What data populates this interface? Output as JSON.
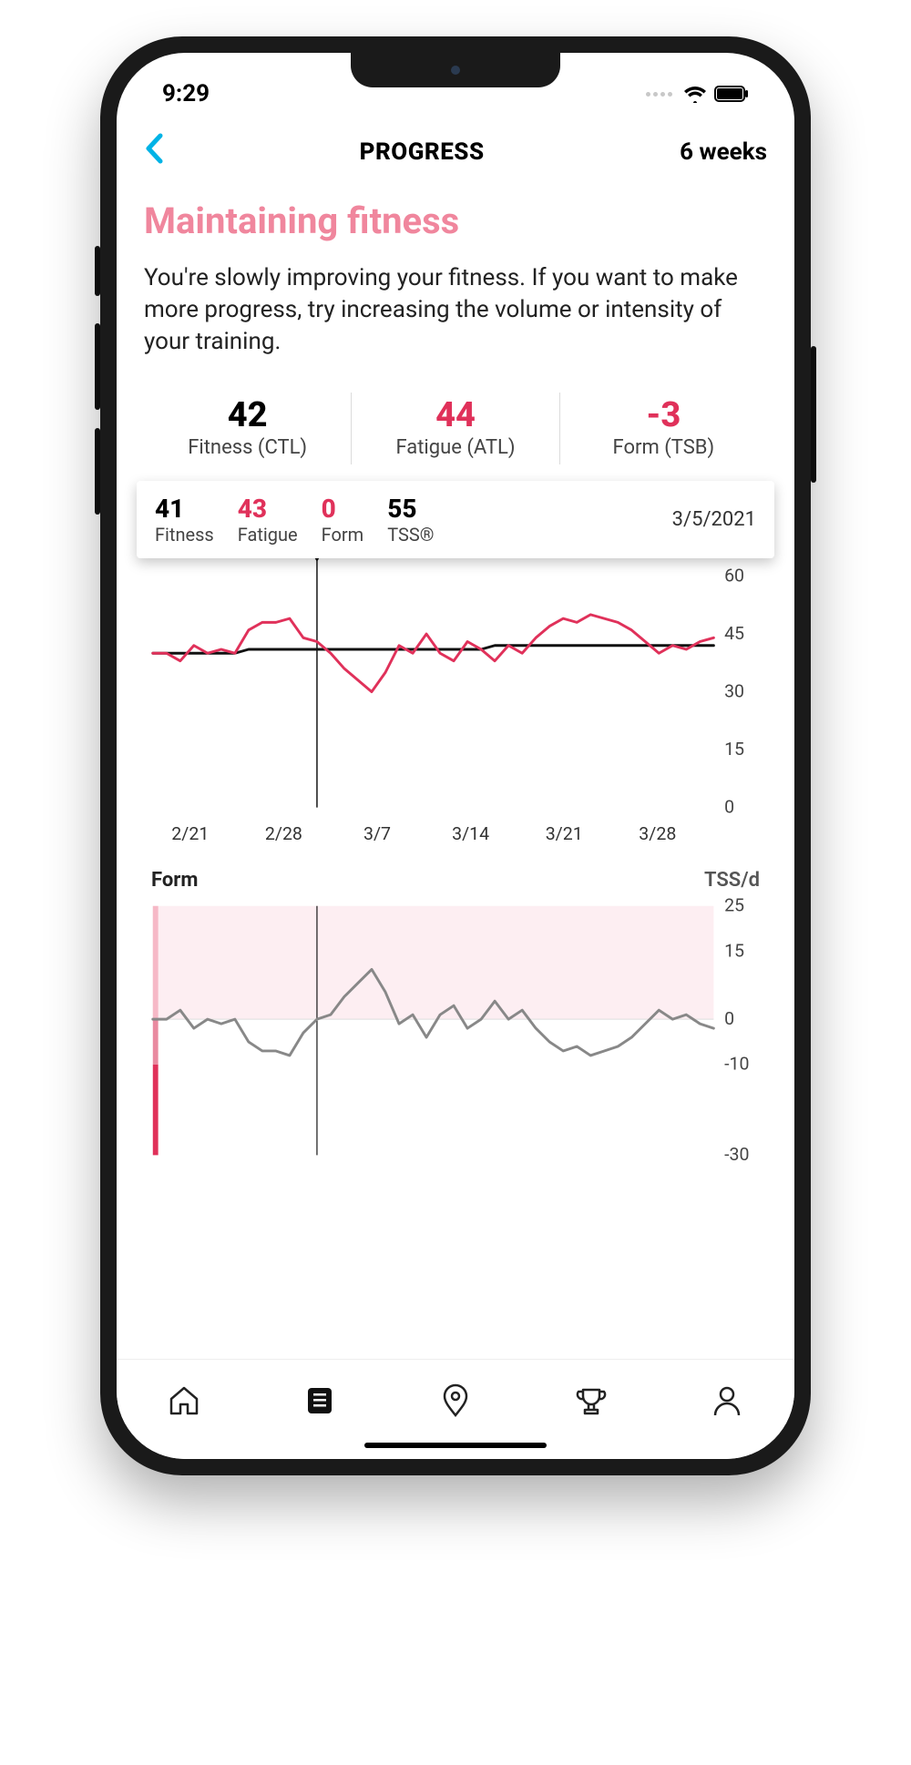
{
  "status": {
    "time": "9:29"
  },
  "nav": {
    "title": "PROGRESS",
    "period": "6 weeks"
  },
  "headline": "Maintaining fitness",
  "body": "You're slowly improving your fitness. If you want to make more progress, try increasing the volume or intensity of your training.",
  "metrics": {
    "fitness": {
      "value": "42",
      "label": "Fitness (CTL)"
    },
    "fatigue": {
      "value": "44",
      "label": "Fatigue (ATL)"
    },
    "form": {
      "value": "-3",
      "label": "Form (TSB)"
    }
  },
  "tooltip": {
    "fitness": {
      "value": "41",
      "label": "Fitness"
    },
    "fatigue": {
      "value": "43",
      "label": "Fatigue"
    },
    "form": {
      "value": "0",
      "label": "Form"
    },
    "tss": {
      "value": "55",
      "label": "TSS®"
    },
    "date": "3/5/2021"
  },
  "form_block": {
    "left": "Form",
    "right": "TSS/d"
  },
  "chart_data": [
    {
      "type": "line",
      "title": "Fitness & Fatigue",
      "xlabel": "",
      "ylabel": "",
      "ylim": [
        0,
        60
      ],
      "yticks": [
        0,
        15,
        30,
        45,
        60
      ],
      "x_categories": [
        "2/21",
        "2/28",
        "3/7",
        "3/14",
        "3/21",
        "3/28"
      ],
      "cursor_x_index": 12,
      "series": [
        {
          "name": "Fitness (CTL)",
          "color": "#111111",
          "values": [
            40,
            40,
            40,
            40,
            40,
            40,
            40,
            41,
            41,
            41,
            41,
            41,
            41,
            41,
            41,
            41,
            41,
            41,
            41,
            41,
            41,
            41,
            41,
            41,
            41,
            42,
            42,
            42,
            42,
            42,
            42,
            42,
            42,
            42,
            42,
            42,
            42,
            42,
            42,
            42,
            42,
            42
          ]
        },
        {
          "name": "Fatigue (ATL)",
          "color": "#e0315a",
          "values": [
            40,
            40,
            38,
            42,
            40,
            41,
            40,
            46,
            48,
            48,
            49,
            44,
            43,
            40,
            36,
            33,
            30,
            35,
            42,
            40,
            45,
            40,
            38,
            43,
            41,
            38,
            42,
            40,
            44,
            47,
            49,
            48,
            50,
            49,
            48,
            46,
            43,
            40,
            42,
            41,
            43,
            44
          ]
        }
      ]
    },
    {
      "type": "line",
      "title": "Form",
      "xlabel": "",
      "ylabel": "TSS/d",
      "ylim": [
        -30,
        25
      ],
      "yticks": [
        -30,
        -10,
        0,
        15,
        25
      ],
      "x_categories": [
        "2/21",
        "2/28",
        "3/7",
        "3/14",
        "3/21",
        "3/28"
      ],
      "cursor_x_index": 12,
      "series": [
        {
          "name": "Form (TSB)",
          "color": "#888888",
          "values": [
            0,
            0,
            2,
            -2,
            0,
            -1,
            0,
            -5,
            -7,
            -7,
            -8,
            -3,
            0,
            1,
            5,
            8,
            11,
            6,
            -1,
            1,
            -4,
            1,
            3,
            -2,
            0,
            4,
            0,
            2,
            -2,
            -5,
            -7,
            -6,
            -8,
            -7,
            -6,
            -4,
            -1,
            2,
            0,
            1,
            -1,
            -2
          ]
        }
      ]
    }
  ]
}
